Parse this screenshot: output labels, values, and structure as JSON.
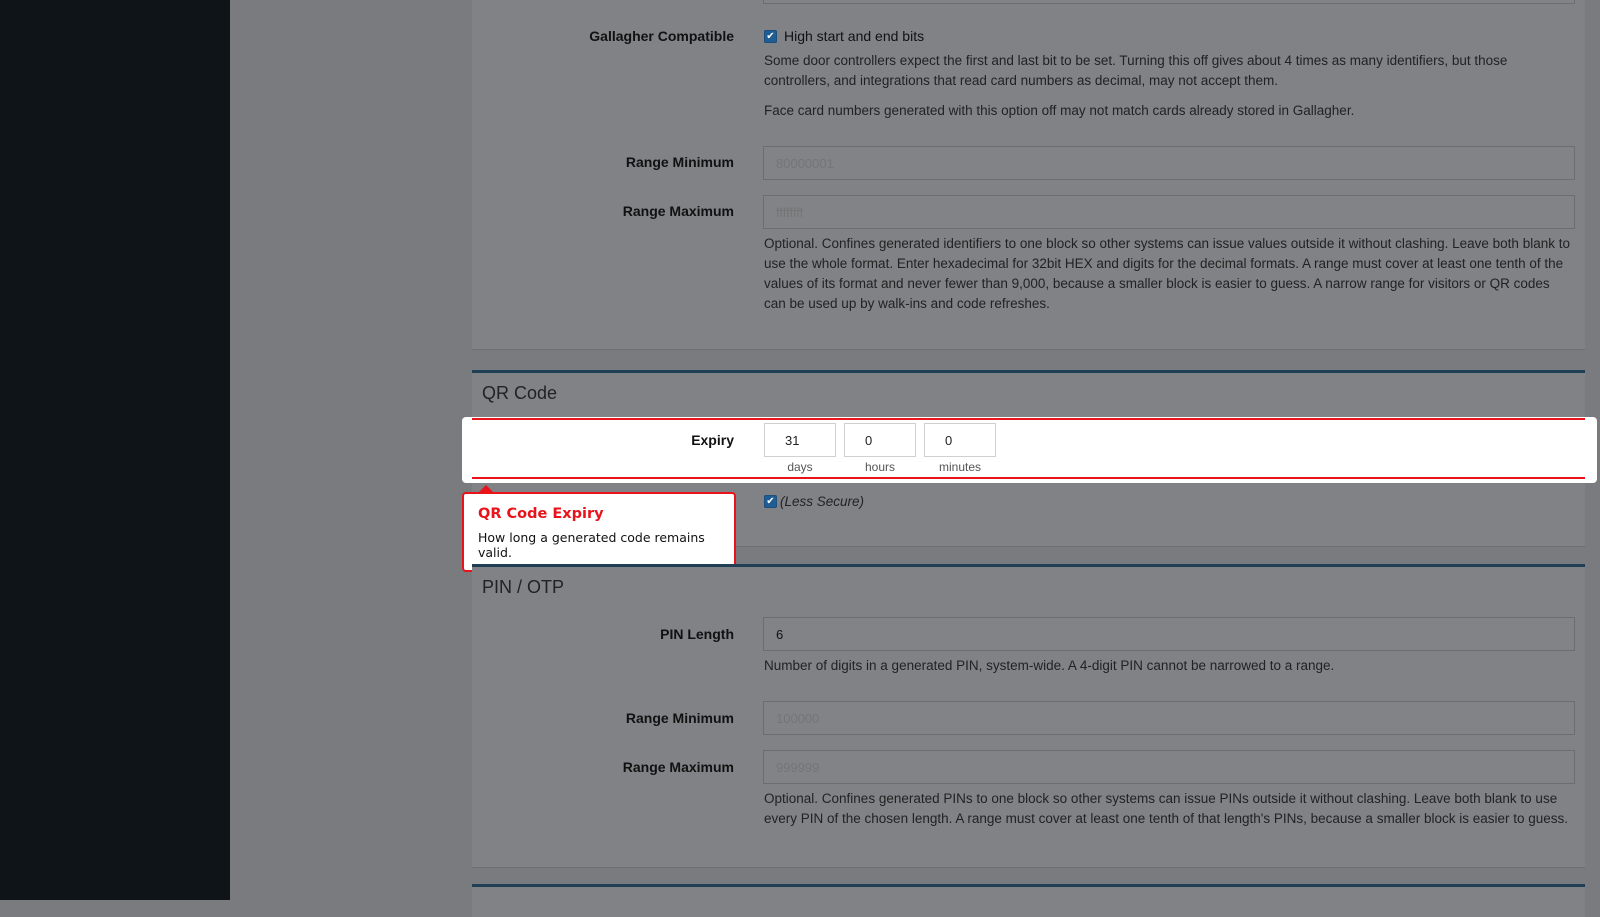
{
  "gallagher": {
    "label": "Gallagher Compatible",
    "checkbox_label": "High start and end bits",
    "help1": "Some door controllers expect the first and last bit to be set. Turning this off gives about 4 times as many identifiers, but those controllers, and integrations that read card numbers as decimal, may not accept them.",
    "help2": "Face card numbers generated with this option off may not match cards already stored in Gallagher."
  },
  "card_range": {
    "min_label": "Range Minimum",
    "min_placeholder": "80000001",
    "max_label": "Range Maximum",
    "max_placeholder": "ffffffff",
    "help": "Optional. Confines generated identifiers to one block so other systems can issue values outside it without clashing. Leave both blank to use the whole format. Enter hexadecimal for 32bit HEX and digits for the decimal formats. A range must cover at least one tenth of the values of its format and never fewer than 9,000, because a smaller block is easier to guess. A narrow range for visitors or QR codes can be used up by walk-ins and code refreshes."
  },
  "qr": {
    "title": "QR Code",
    "expiry_label": "Expiry",
    "days": "31",
    "hours": "0",
    "minutes": "0",
    "days_caption": "days",
    "hours_caption": "hours",
    "minutes_caption": "minutes",
    "less_secure_label": "(Less Secure)"
  },
  "tooltip": {
    "title": "QR Code Expiry",
    "body": "How long a generated code remains valid."
  },
  "pin": {
    "title": "PIN / OTP",
    "length_label": "PIN Length",
    "length_value": "6",
    "length_help": "Number of digits in a generated PIN, system-wide. A 4-digit PIN cannot be narrowed to a range.",
    "min_label": "Range Minimum",
    "min_placeholder": "100000",
    "max_label": "Range Maximum",
    "max_placeholder": "999999",
    "help": "Optional. Confines generated PINs to one block so other systems can issue PINs outside it without clashing. Leave both blank to use every PIN of the chosen length. A range must cover at least one tenth of that length's PINs, because a smaller block is easier to guess."
  },
  "colors": {
    "accent": "#e8131b",
    "section_border": "#1f3f55",
    "checkbox": "#1f5d94",
    "sidebar": "#0f1418"
  }
}
